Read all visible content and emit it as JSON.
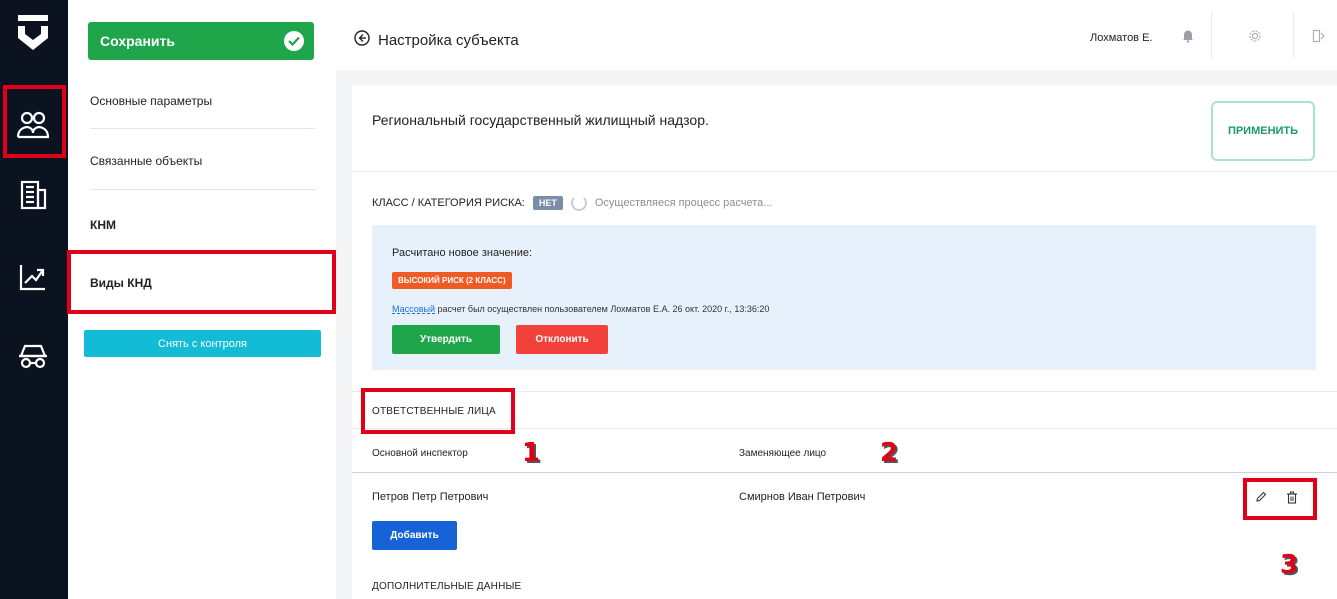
{
  "menu": {
    "save_label": "Сохранить",
    "items": [
      "Основные параметры",
      "Связанные объекты",
      "КНМ",
      "Виды КНД"
    ],
    "unctrl_label": "Снять с контроля"
  },
  "topbar": {
    "title": "Настройка субъекта",
    "user": "Лохматов Е."
  },
  "card": {
    "heading": "Региональный государственный жилищный надзор.",
    "apply_label": "ПРИМЕНИТЬ",
    "risk_label": "КЛАСС / КАТЕГОРИЯ РИСКА:",
    "risk_badge": "НЕТ",
    "risk_status": "Осуществляеся процесс расчета...",
    "new_value_title": "Расчитано новое значение:",
    "high_risk": "ВЫСОКИЙ РИСК (2 КЛАСС)",
    "calc_link": "Массовый",
    "calc_text": " расчет был осуществлен пользователем Лохматов Е.А. 26 окт. 2020 г., 13:36:20",
    "approve_label": "Утвердить",
    "reject_label": "Отклонить",
    "responsible_title": "ОТВЕТСТВЕННЫЕ ЛИЦА",
    "col_main": "Основной инспектор",
    "col_replace": "Заменяющее лицо",
    "row_main": "Петров Петр Петрович",
    "row_replace": "Смирнов Иван Петрович",
    "add_label": "Добавить",
    "extra_title": "ДОПОЛНИТЕЛЬНЫЕ ДАННЫЕ"
  },
  "annotations": [
    "1",
    "2",
    "3"
  ],
  "colors": {
    "rail": "#0b1320",
    "save_green": "#1fa54a",
    "cyan": "#12bcd6",
    "annotation_red": "#e0001a"
  },
  "icons": [
    "logo-icon",
    "people-icon",
    "building-icon",
    "chart-icon",
    "car-icon",
    "back-arrow-icon",
    "bell-icon",
    "gear-icon",
    "logout-icon",
    "pencil-icon",
    "trash-icon",
    "check-icon"
  ]
}
